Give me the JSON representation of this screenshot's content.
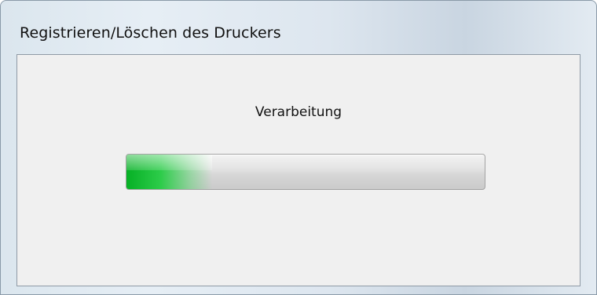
{
  "window": {
    "title": "Registrieren/Löschen des Druckers"
  },
  "dialog": {
    "status_text": "Verarbeitung",
    "progress_value": 0.24
  },
  "colors": {
    "progress_accent": "#06b025",
    "client_background": "#f0f0f0"
  }
}
